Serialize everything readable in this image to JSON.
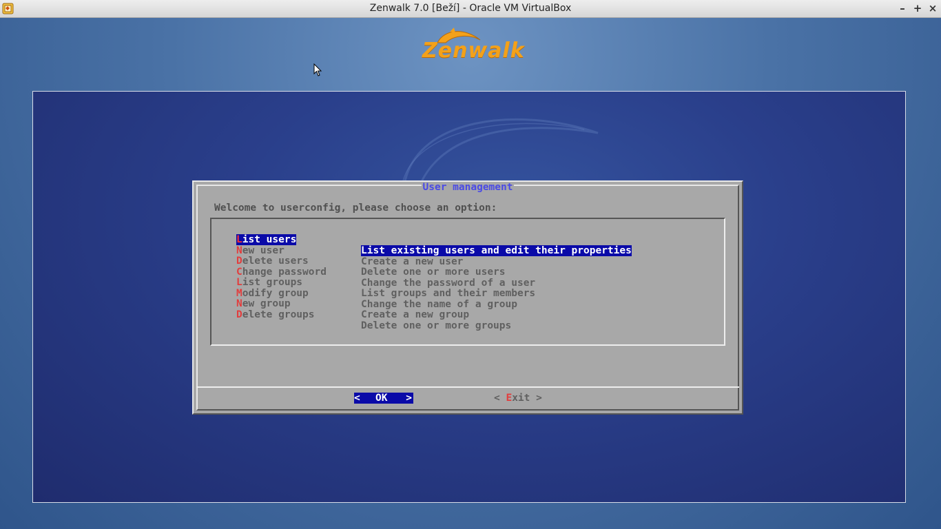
{
  "window": {
    "title": "Zenwalk 7.0 [Beží] - Oracle VM VirtualBox",
    "app_icon": "virtualbox-icon",
    "controls": {
      "minimize": "–",
      "maximize": "+",
      "close": "×"
    }
  },
  "logo": {
    "text": "Zenwalk",
    "color": "#f3a11a"
  },
  "dialog": {
    "title": "User management",
    "prompt": "Welcome to userconfig, please choose an option:",
    "menu": [
      {
        "hot": "L",
        "rest": "ist users",
        "desc": "List existing users and edit their properties",
        "selected": true
      },
      {
        "hot": "N",
        "rest": "ew user",
        "desc": "Create a new user",
        "selected": false
      },
      {
        "hot": "D",
        "rest": "elete users",
        "desc": "Delete one or more users",
        "selected": false
      },
      {
        "hot": "C",
        "rest": "hange password",
        "desc": "Change the password of a user",
        "selected": false
      },
      {
        "hot": "L",
        "rest": "ist groups",
        "desc": "List groups and their members",
        "selected": false
      },
      {
        "hot": "M",
        "rest": "odify group",
        "desc": "Change the name of a group",
        "selected": false
      },
      {
        "hot": "N",
        "rest": "ew group",
        "desc": "Create a new group",
        "selected": false
      },
      {
        "hot": "D",
        "rest": "elete groups",
        "desc": "Delete one or more groups",
        "selected": false
      }
    ],
    "buttons": {
      "ok": {
        "left": "<",
        "label": "OK",
        "right": ">"
      },
      "exit": {
        "left": "<",
        "hot": "E",
        "rest": "xit",
        "right": ">"
      }
    }
  },
  "colors": {
    "selection": "#0a0aa8",
    "hotkey": "#e23d3d",
    "dialog_bg": "#a8a8a8",
    "title_text": "#4a4ae6"
  }
}
